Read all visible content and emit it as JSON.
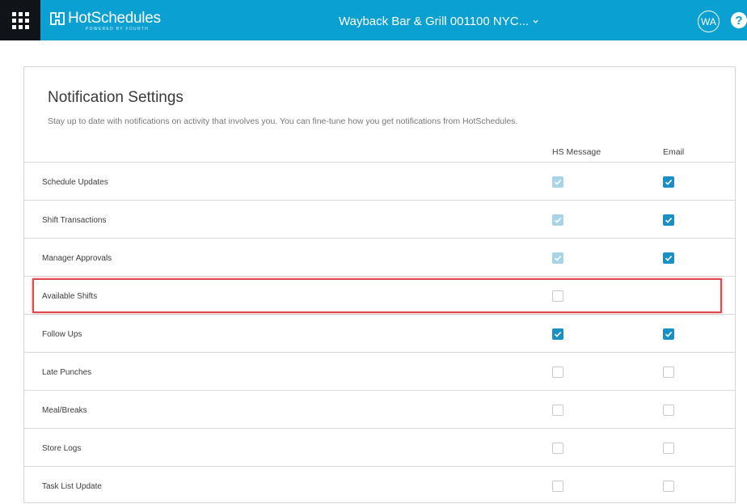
{
  "header": {
    "brand": "HotSchedules",
    "brand_tagline": "POWERED BY FOURTH",
    "store_name": "Wayback Bar & Grill 001100 NYC...",
    "user_initials": "WA",
    "help_label": "?",
    "colors": {
      "bar": "#0aa0d2",
      "apps_button": "#101418"
    }
  },
  "page": {
    "title": "Notification Settings",
    "subtitle": "Stay up to date with notifications on activity that involves you. You can fine-tune how you get notifications from HotSchedules.",
    "columns": {
      "hs_message": "HS Message",
      "email": "Email"
    }
  },
  "rows": [
    {
      "label": "Schedule Updates",
      "hs": "faded",
      "email": "checked"
    },
    {
      "label": "Shift Transactions",
      "hs": "faded",
      "email": "checked"
    },
    {
      "label": "Manager Approvals",
      "hs": "faded",
      "email": "checked"
    },
    {
      "label": "Available Shifts",
      "hs": "unchecked",
      "email": "none"
    },
    {
      "label": "Follow Ups",
      "hs": "checked",
      "email": "checked"
    },
    {
      "label": "Late Punches",
      "hs": "unchecked",
      "email": "unchecked"
    },
    {
      "label": "Meal/Breaks",
      "hs": "unchecked",
      "email": "unchecked"
    },
    {
      "label": "Store Logs",
      "hs": "unchecked",
      "email": "unchecked"
    },
    {
      "label": "Task List Update",
      "hs": "unchecked",
      "email": "unchecked"
    }
  ],
  "annotation": {
    "highlighted_row": "Available Shifts",
    "color": "#e1474d"
  }
}
